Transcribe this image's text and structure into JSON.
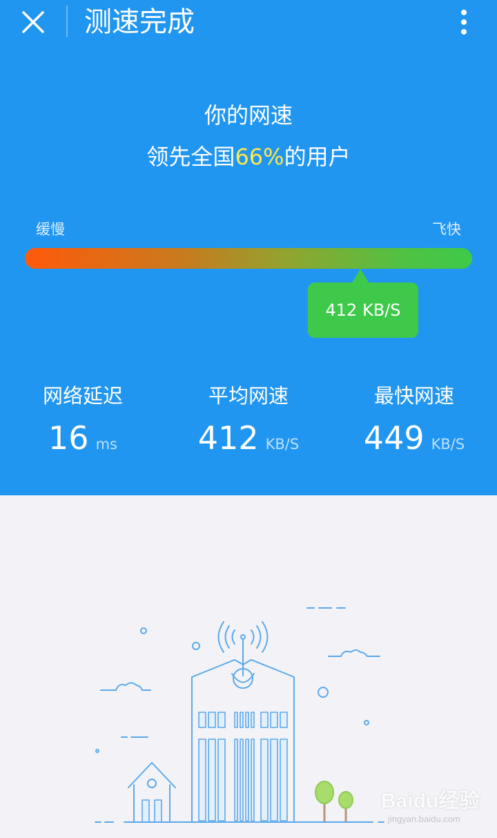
{
  "header": {
    "title": "测速完成"
  },
  "result": {
    "line1": "你的网速",
    "line2_prefix": "领先全国",
    "line2_percent": "66%",
    "line2_suffix": "的用户",
    "percentile": 66
  },
  "speed_scale": {
    "slow_label": "缓慢",
    "fast_label": "飞快",
    "current_label": "412 KB/S",
    "position_fraction": 0.75
  },
  "stats": [
    {
      "label": "网络延迟",
      "value": "16",
      "unit": "ms"
    },
    {
      "label": "平均网速",
      "value": "412",
      "unit": "KB/S"
    },
    {
      "label": "最快网速",
      "value": "449",
      "unit": "KB/S"
    }
  ],
  "watermark": {
    "text": "Baidu经验",
    "sub": "jingyan.baidu.com"
  },
  "colors": {
    "header_bg": "#2196f0",
    "accent_percent": "#ffe84c",
    "bubble_green": "#3fc94a",
    "bar_start": "#ff5a0a",
    "bar_end": "#3fc94a",
    "illustration_line": "#5aa8ea"
  },
  "icons": {
    "close": "close-icon",
    "more": "more-vertical-icon"
  }
}
